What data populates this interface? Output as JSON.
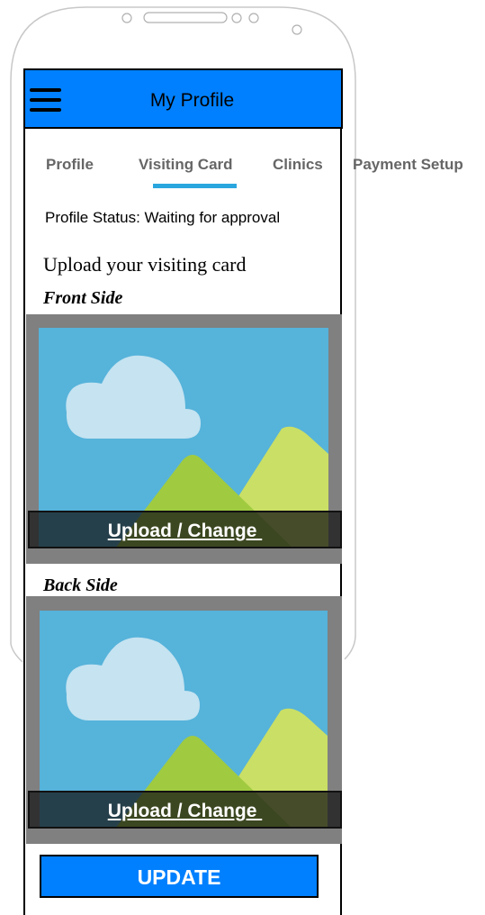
{
  "header": {
    "title": "My Profile",
    "menu_icon": "hamburger-menu-icon"
  },
  "tabs": [
    {
      "label": "Profile",
      "selected": false
    },
    {
      "label": "Visiting Card",
      "selected": true
    },
    {
      "label": "Clinics",
      "selected": false
    },
    {
      "label": "Payment Setup",
      "selected": false
    }
  ],
  "status": {
    "text": "Profile Status: Waiting for approval"
  },
  "upload": {
    "heading": "Upload your visiting card",
    "front": {
      "label": "Front Side",
      "upload_label": "Upload / Change "
    },
    "back": {
      "label": "Back Side",
      "upload_label": "Upload / Change "
    }
  },
  "update_button": {
    "label": "UPDATE"
  },
  "colors": {
    "header_bg": "#0080ff",
    "tab_indicator": "#2aa6df",
    "image_sky": "#56b3da",
    "cloud": "#c5e3f1",
    "mountain_dark": "#a0cb40",
    "mountain_light": "#cadf65"
  }
}
